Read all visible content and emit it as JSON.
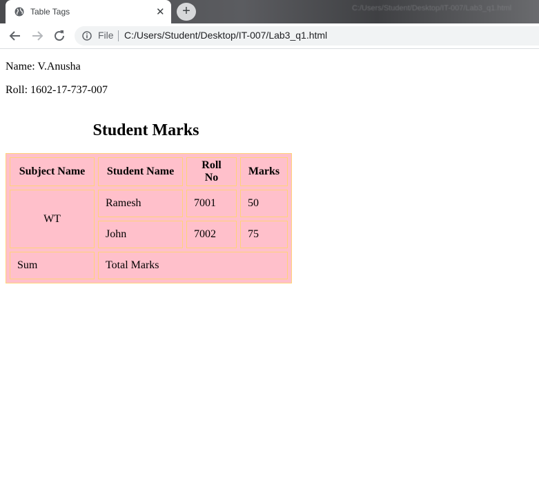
{
  "browser": {
    "tab_title": "Table Tags",
    "tab_close": "✕",
    "new_tab": "+",
    "scheme_label": "File",
    "url": "C:/Users/Student/Desktop/IT-007/Lab3_q1.html",
    "titlebar_ghost": "C:/Users/Student/Desktop/IT-007/Lab3_q1.html",
    "icons": [
      "globe-icon",
      "back-arrow-icon",
      "forward-arrow-icon",
      "reload-icon",
      "info-icon"
    ]
  },
  "page": {
    "name_line": "Name: V.Anusha",
    "roll_line": "Roll: 1602-17-737-007",
    "heading": "Student Marks",
    "table": {
      "headers": [
        "Subject Name",
        "Student Name",
        "Roll No",
        "Marks"
      ],
      "subject": "WT",
      "rows": [
        {
          "student": "Ramesh",
          "roll": "7001",
          "marks": "50"
        },
        {
          "student": "John",
          "roll": "7002",
          "marks": "75"
        }
      ],
      "footer": {
        "label": "Sum",
        "value": "Total Marks"
      }
    },
    "colors": {
      "cell_background": "#ffc0cb",
      "border": "#ffd27a"
    }
  }
}
